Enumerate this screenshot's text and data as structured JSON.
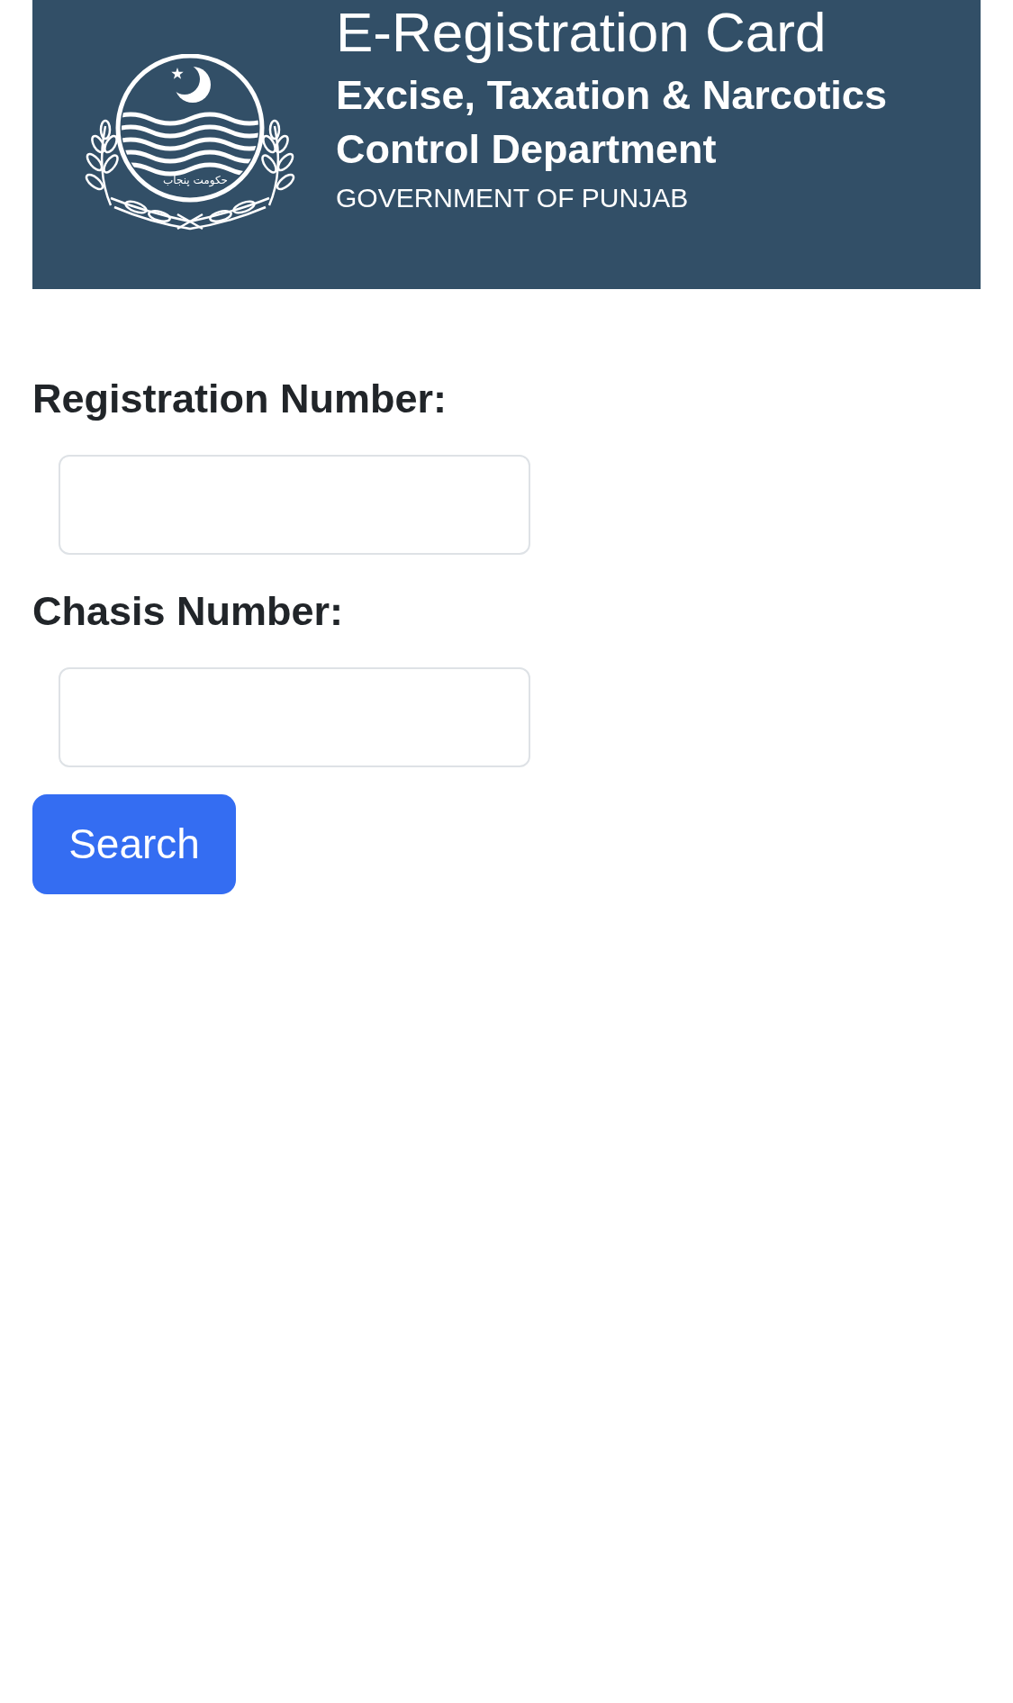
{
  "header": {
    "title": "E-Registration Card",
    "banner": {
      "emblem_caption": "حکومت پنجاب",
      "department": "Excise, Taxation & Narcotics Control Department",
      "government": "GOVERNMENT OF PUNJAB"
    }
  },
  "form": {
    "fields": [
      {
        "label": "Registration Number:"
      },
      {
        "label": "Chasis Number:"
      }
    ],
    "button": "Search"
  }
}
